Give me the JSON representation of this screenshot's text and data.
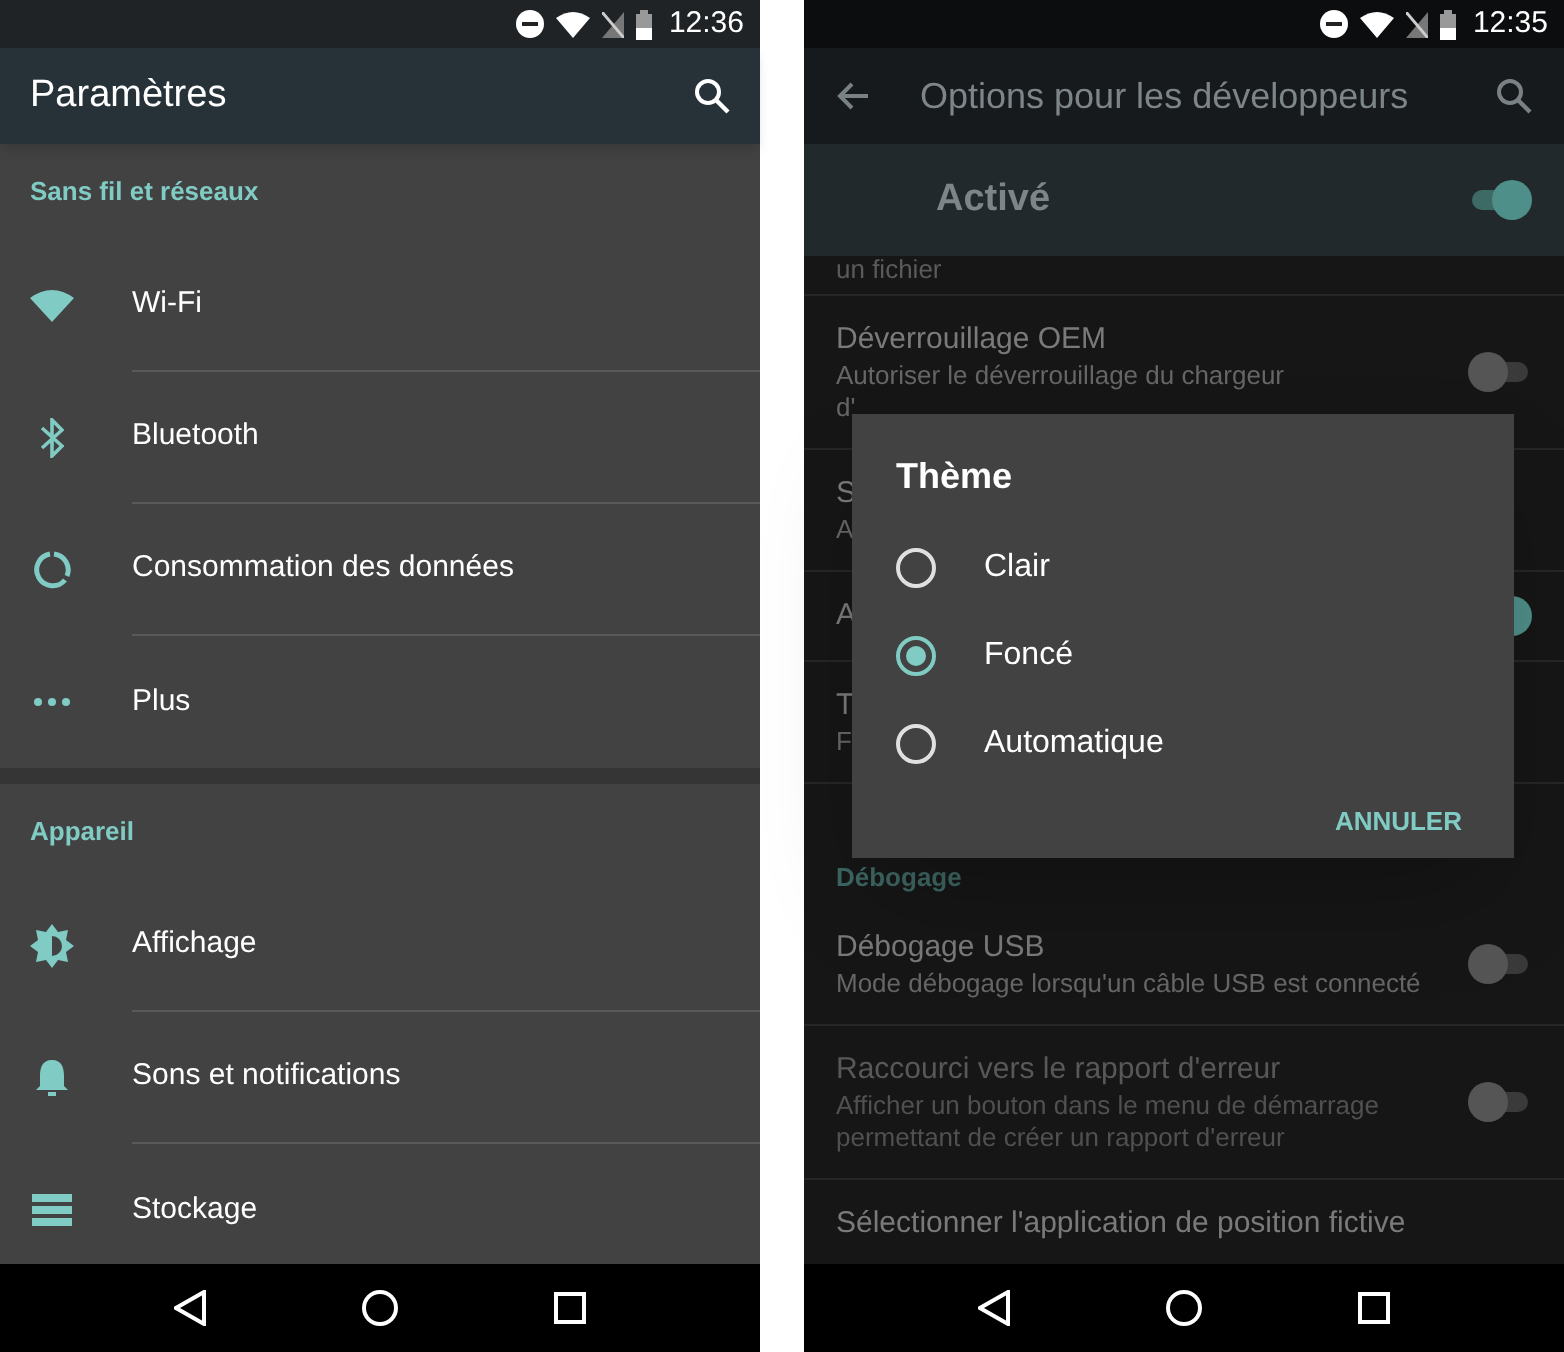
{
  "settings_screen": {
    "status_bar": {
      "time": "12:36"
    },
    "title": "Paramètres",
    "sections": [
      {
        "header": "Sans fil et réseaux",
        "items": [
          {
            "kind": "wifi",
            "label": "Wi-Fi"
          },
          {
            "kind": "bluetooth",
            "label": "Bluetooth"
          },
          {
            "kind": "data",
            "label": "Consommation des données"
          },
          {
            "kind": "more",
            "label": "Plus"
          }
        ]
      },
      {
        "header": "Appareil",
        "items": [
          {
            "kind": "display",
            "label": "Affichage"
          },
          {
            "kind": "sound",
            "label": "Sons et notifications"
          },
          {
            "kind": "storage",
            "label": "Stockage"
          }
        ]
      }
    ]
  },
  "developer_screen": {
    "status_bar": {
      "time": "12:35"
    },
    "title": "Options pour les développeurs",
    "master_switch": {
      "label": "Activé",
      "on": true
    },
    "items": [
      {
        "kind": "fragment",
        "text": "un fichier"
      },
      {
        "kind": "setting",
        "title": "Déverrouillage OEM",
        "subtitle": [
          "Autoriser le déverrouillage du chargeur",
          "d'"
        ],
        "on": false,
        "disabled": false
      },
      {
        "kind": "setting",
        "title": "S",
        "subtitle": [
          "A"
        ],
        "disabled": false
      },
      {
        "kind": "setting",
        "title": "A",
        "on": true,
        "disabled": false
      },
      {
        "kind": "setting",
        "title": "T",
        "subtitle": [
          "F"
        ],
        "disabled": false
      },
      {
        "kind": "header",
        "text": "Débogage"
      },
      {
        "kind": "setting",
        "title": "Débogage USB",
        "subtitle": [
          "Mode débogage lorsqu'un câble USB est connecté"
        ],
        "on": false,
        "disabled": false
      },
      {
        "kind": "setting",
        "title": "Raccourci vers le rapport d'erreur",
        "subtitle": [
          "Afficher un bouton dans le menu de démarrage",
          "permettant de créer un rapport d'erreur"
        ],
        "on": false,
        "disabled": true
      },
      {
        "kind": "setting",
        "title": "Sélectionner l'application de position fictive",
        "disabled": false
      }
    ],
    "dialog": {
      "title": "Thème",
      "options": [
        {
          "label": "Clair",
          "selected": false
        },
        {
          "label": "Foncé",
          "selected": true
        },
        {
          "label": "Automatique",
          "selected": false
        }
      ],
      "button": "ANNULER"
    }
  }
}
